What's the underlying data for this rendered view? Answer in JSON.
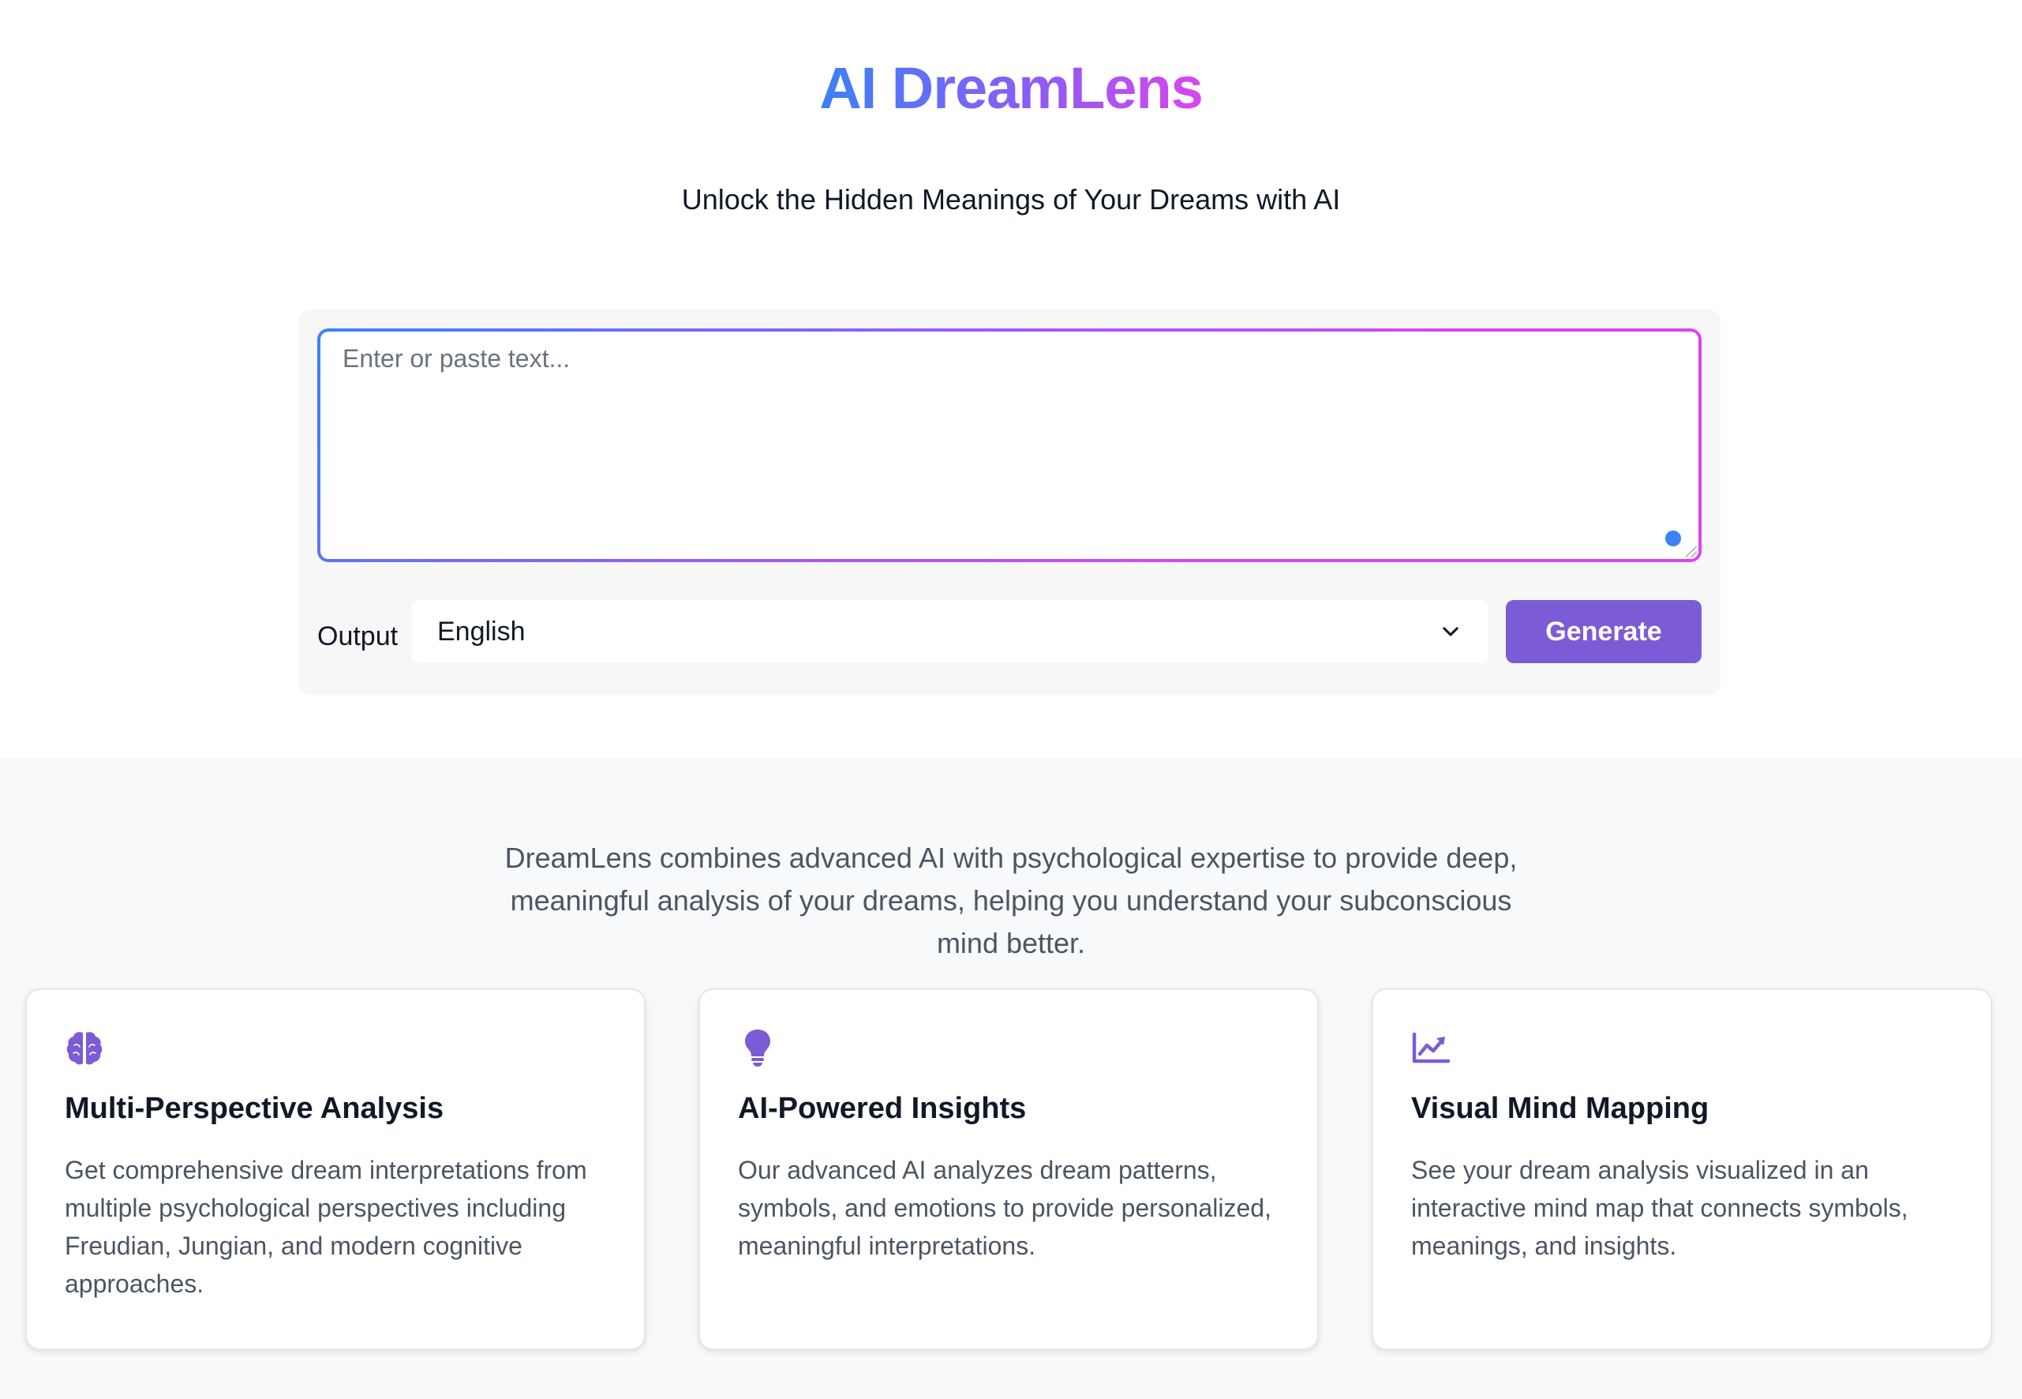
{
  "header": {
    "title": "AI DreamLens",
    "subtitle": "Unlock the Hidden Meanings of Your Dreams with AI"
  },
  "input": {
    "placeholder": "Enter or paste text...",
    "value": ""
  },
  "output": {
    "label": "Output",
    "selected": "English",
    "options": [
      "English"
    ]
  },
  "generate_button": "Generate",
  "features": {
    "intro": "DreamLens combines advanced AI with psychological expertise to provide deep, meaningful analysis of your dreams, helping you understand your subconscious mind better.",
    "cards": [
      {
        "icon": "brain-icon",
        "title": "Multi-Perspective Analysis",
        "description": "Get comprehensive dream interpretations from multiple psychological perspectives including Freudian, Jungian, and modern cognitive approaches."
      },
      {
        "icon": "lightbulb-icon",
        "title": "AI-Powered Insights",
        "description": "Our advanced AI analyzes dream patterns, symbols, and emotions to provide personalized, meaningful interpretations."
      },
      {
        "icon": "chart-line-icon",
        "title": "Visual Mind Mapping",
        "description": "See your dream analysis visualized in an interactive mind map that connects symbols, meanings, and insights."
      }
    ]
  },
  "colors": {
    "accent": "#7c5cd6",
    "gradient_start": "#3b82f6",
    "gradient_end": "#d946ef",
    "icon": "#7c5cd6"
  }
}
